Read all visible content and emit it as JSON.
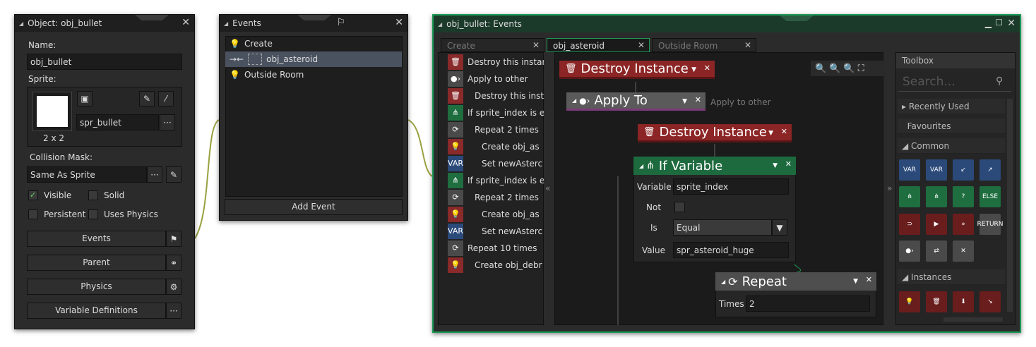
{
  "object_window": {
    "title": "Object: obj_bullet",
    "name_label": "Name:",
    "name_value": "obj_bullet",
    "sprite_label": "Sprite:",
    "sprite_size": "2 x 2",
    "sprite_value": "spr_bullet",
    "collision_label": "Collision Mask:",
    "collision_value": "Same As Sprite",
    "visible": "Visible",
    "solid": "Solid",
    "persistent": "Persistent",
    "uses_physics": "Uses Physics",
    "events_btn": "Events",
    "parent_btn": "Parent",
    "physics_btn": "Physics",
    "vardefs_btn": "Variable Definitions",
    "more": "···"
  },
  "events_window": {
    "title": "Events",
    "items": [
      "Create",
      "obj_asteroid",
      "Outside Room"
    ],
    "add_event": "Add Event"
  },
  "code_window": {
    "title": "obj_bullet: Events",
    "tabs": [
      "Create",
      "obj_asteroid",
      "Outside Room"
    ],
    "list": [
      "Destroy this instanc",
      "Apply to other",
      "Destroy this insta",
      "If sprite_index is e",
      "Repeat 2 times",
      "Create obj_as",
      "Set newAsterc",
      "If sprite_index is e",
      "Repeat 2 times",
      "Create obj_as",
      "Set newAsterc",
      "Repeat 10 times",
      "Create obj_debr"
    ],
    "blocks": {
      "destroy1": "Destroy Instance",
      "apply": "Apply To",
      "apply_hint": "Apply to other",
      "destroy2": "Destroy Instance",
      "ifvar": "If Variable",
      "variable_label": "Variable",
      "variable_value": "sprite_index",
      "not_label": "Not",
      "is_label": "Is",
      "is_value": "Equal",
      "value_label": "Value",
      "value_value": "spr_asteroid_huge",
      "repeat": "Repeat",
      "times_label": "Times",
      "times_value": "2"
    },
    "toolbox": {
      "title": "Toolbox",
      "search": "Search...",
      "recent": "Recently Used",
      "favourites": "Favourites",
      "common": "Common",
      "instances": "Instances",
      "else": "ELSE",
      "var": "VAR",
      "return": "RETURN"
    },
    "collapse_left": "«",
    "collapse_right": "»"
  }
}
